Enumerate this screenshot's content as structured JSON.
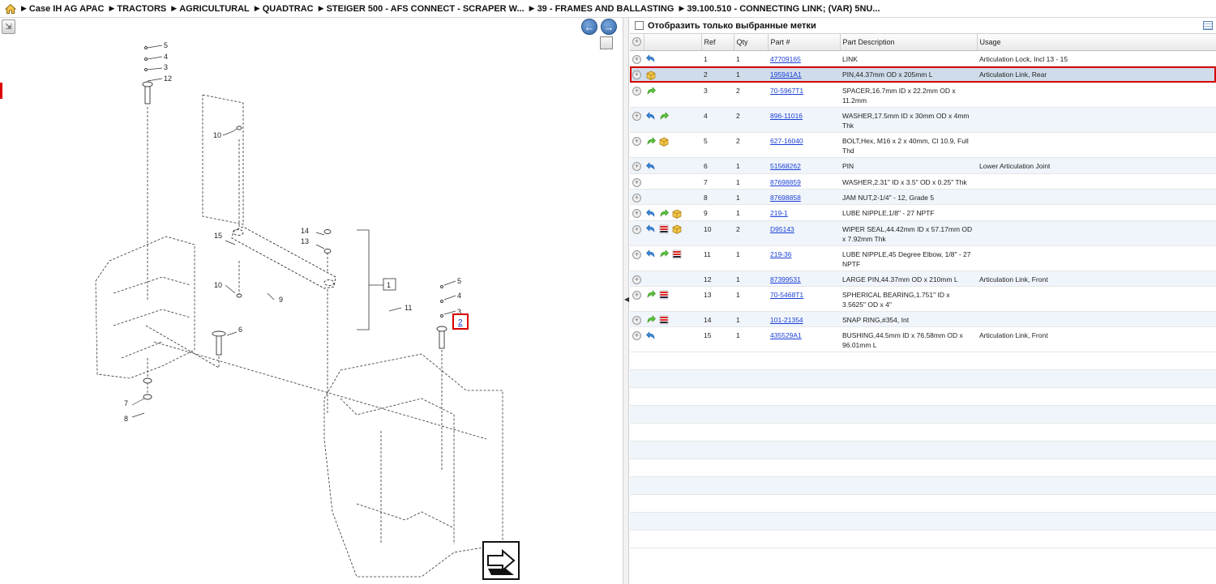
{
  "breadcrumb": [
    "Case IH AG APAC",
    "TRACTORS",
    "AGRICULTURAL",
    "QUADTRAC",
    "STEIGER 500 - AFS CONNECT - SCRAPER W...",
    "39 - FRAMES AND BALLASTING",
    "39.100.510 - CONNECTING LINK; (VAR) 5NU..."
  ],
  "diagram": {
    "callouts": [
      "5",
      "4",
      "3",
      "12",
      "10",
      "15",
      "14",
      "13",
      "1",
      "10",
      "9",
      "11",
      "6",
      "5",
      "4",
      "3",
      "2",
      "7",
      "8"
    ],
    "selected_callout": "2"
  },
  "filter": {
    "label": "Отобразить только выбранные метки",
    "checked": false
  },
  "table": {
    "columns": [
      "Ref",
      "Qty",
      "Part #",
      "Part Description",
      "Usage"
    ],
    "rows": [
      {
        "ref": "1",
        "qty": "1",
        "part": "47709165",
        "desc": "LINK",
        "usage": "Articulation Lock, Incl 13 - 15",
        "icons": [
          "back-arrow-icon"
        ]
      },
      {
        "ref": "2",
        "qty": "1",
        "part": "195941A1",
        "desc": "PIN,44.37mm OD x 205mm L",
        "usage": "Articulation Link, Rear",
        "icons": [
          "package-icon"
        ],
        "selected": true
      },
      {
        "ref": "3",
        "qty": "2",
        "part": "70-5967T1",
        "desc": "SPACER,16.7mm ID x 22.2mm OD x 11.2mm",
        "usage": "",
        "icons": [
          "forward-arrow-icon"
        ]
      },
      {
        "ref": "4",
        "qty": "2",
        "part": "896-11016",
        "desc": "WASHER,17.5mm ID x 30mm OD x 4mm Thk",
        "usage": "",
        "icons": [
          "back-arrow-icon",
          "forward-arrow-icon"
        ]
      },
      {
        "ref": "5",
        "qty": "2",
        "part": "627-16040",
        "desc": "BOLT,Hex, M16 x 2 x 40mm, Cl 10.9, Full Thd",
        "usage": "",
        "icons": [
          "forward-arrow-icon",
          "package-icon"
        ]
      },
      {
        "ref": "6",
        "qty": "1",
        "part": "51568262",
        "desc": "PIN",
        "usage": "Lower Articulation Joint",
        "icons": [
          "back-arrow-icon"
        ]
      },
      {
        "ref": "7",
        "qty": "1",
        "part": "87698859",
        "desc": "WASHER,2.31\" ID x 3.5\" OD x 0.25\" Thk",
        "usage": "",
        "icons": []
      },
      {
        "ref": "8",
        "qty": "1",
        "part": "87698858",
        "desc": "JAM NUT,2-1/4\" - 12, Grade 5",
        "usage": "",
        "icons": []
      },
      {
        "ref": "9",
        "qty": "1",
        "part": "219-1",
        "desc": "LUBE NIPPLE,1/8\" - 27 NPTF",
        "usage": "",
        "icons": [
          "back-arrow-icon",
          "forward-arrow-icon",
          "package-icon"
        ]
      },
      {
        "ref": "10",
        "qty": "2",
        "part": "D95143",
        "desc": "WIPER SEAL,44.42mm ID x 57.17mm OD x 7.92mm Thk",
        "usage": "",
        "icons": [
          "back-arrow-icon",
          "list-icon",
          "package-icon"
        ]
      },
      {
        "ref": "11",
        "qty": "1",
        "part": "219-36",
        "desc": "LUBE NIPPLE,45 Degree Elbow, 1/8\" - 27 NPTF",
        "usage": "",
        "icons": [
          "back-arrow-icon",
          "forward-arrow-icon",
          "list-icon"
        ]
      },
      {
        "ref": "12",
        "qty": "1",
        "part": "87399531",
        "desc": "LARGE PIN,44.37mm OD x 210mm L",
        "usage": "Articulation Link, Front",
        "icons": []
      },
      {
        "ref": "13",
        "qty": "1",
        "part": "70-5468T1",
        "desc": "SPHERICAL BEARING,1.751\" ID x 3.5625\" OD x 4\"",
        "usage": "",
        "icons": [
          "forward-arrow-icon",
          "list-icon"
        ]
      },
      {
        "ref": "14",
        "qty": "1",
        "part": "101-21354",
        "desc": "SNAP RING,#354, Int",
        "usage": "",
        "icons": [
          "forward-arrow-icon",
          "list-icon"
        ]
      },
      {
        "ref": "15",
        "qty": "1",
        "part": "435529A1",
        "desc": "BUSHING,44.5mm ID x 76.58mm OD x 96.01mm L",
        "usage": "Articulation Link, Front",
        "icons": [
          "back-arrow-icon"
        ]
      }
    ]
  },
  "colors": {
    "selected_outline": "#d80000",
    "link": "#1a3fd6",
    "row_alt": "#f0f5fb",
    "row_selected": "#cfdcea"
  }
}
